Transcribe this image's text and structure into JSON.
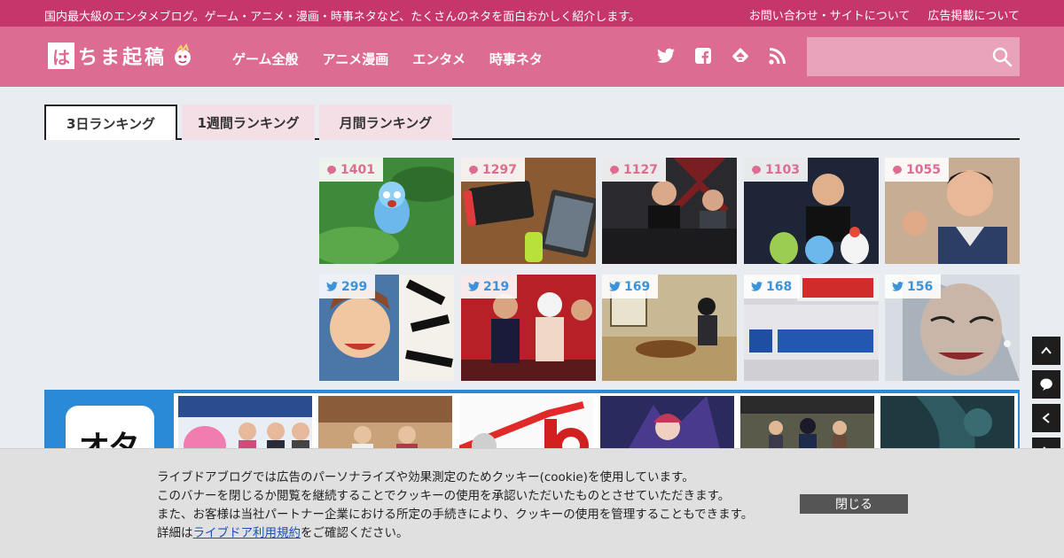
{
  "topbar": {
    "tagline": "国内最大級のエンタメブログ。ゲーム・アニメ・漫画・時事ネタなど、たくさんのネタを面白おかしく紹介します。",
    "links": [
      "お問い合わせ・サイトについて",
      "広告掲載について"
    ]
  },
  "header": {
    "logo_mark": "は",
    "logo_text": "ちま起稿",
    "nav": [
      "ゲーム全般",
      "アニメ漫画",
      "エンタメ",
      "時事ネタ"
    ],
    "social_icons": [
      "twitter-icon",
      "facebook-icon",
      "feedly-icon",
      "rss-icon"
    ],
    "search_placeholder": ""
  },
  "ranking": {
    "tabs": [
      "3日ランキング",
      "1週間ランキング",
      "月間ランキング"
    ],
    "active_tab": 0,
    "comment_counts": [
      "1401",
      "1297",
      "1127",
      "1103",
      "1055"
    ],
    "tweet_counts": [
      "299",
      "219",
      "169",
      "168",
      "156"
    ]
  },
  "promo": {
    "app_label": "オタ"
  },
  "cookie": {
    "line1": "ライブドアブログでは広告のパーソナライズや効果測定のためクッキー(cookie)を使用しています。",
    "line2": "このバナーを閉じるか閲覧を継続することでクッキーの使用を承認いただいたものとさせていただきます。",
    "line3": "また、お客様は当社パートナー企業における所定の手続きにより、クッキーの使用を管理することもできます。",
    "line4_prefix": "詳細は",
    "line4_link": "ライブドア利用規約",
    "line4_suffix": "をご確認ください。",
    "close_label": "閉じる"
  },
  "colors": {
    "topbar": "#c5366a",
    "navbar": "#dc6c92",
    "comment_badge": "#dc6c92",
    "tweet_badge": "#3b94d9",
    "promo": "#2b8ad8"
  }
}
